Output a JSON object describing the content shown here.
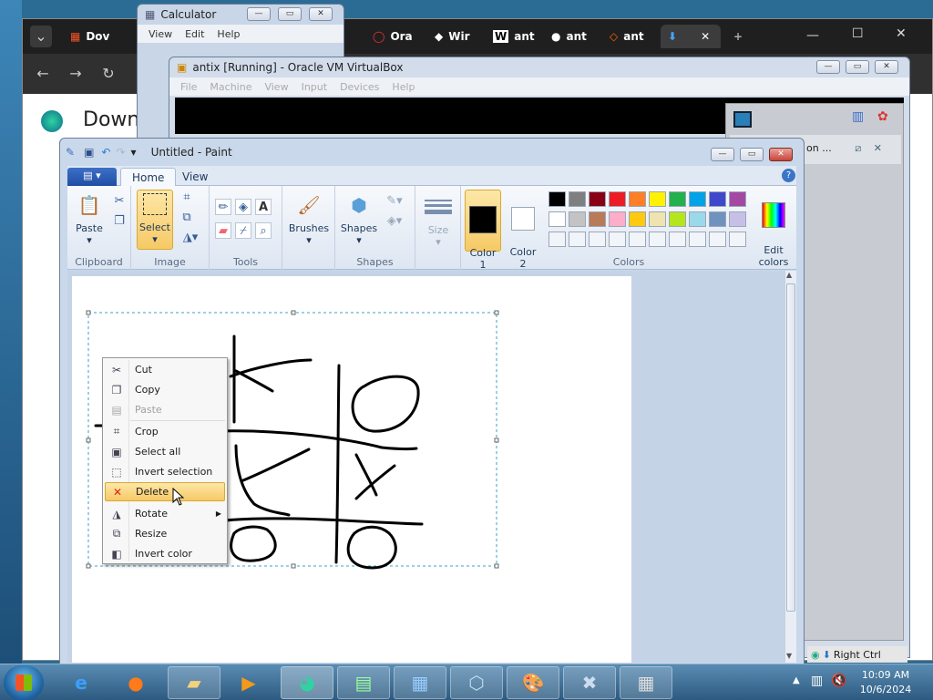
{
  "browser": {
    "tabs": [
      "Dov",
      "Ora",
      "Wir",
      "ant",
      "ant",
      "ant"
    ],
    "download_heading": "Down",
    "new_tab_symbol": "+"
  },
  "calculator": {
    "title": "Calculator",
    "menu": [
      "View",
      "Edit",
      "Help"
    ]
  },
  "virtualbox": {
    "title": "antix [Running] - Oracle VM VirtualBox",
    "menu": [
      "File",
      "Machine",
      "View",
      "Input",
      "Devices",
      "Help"
    ],
    "side_text": "on ...",
    "status_text": "Right Ctrl"
  },
  "paint": {
    "title": "Untitled - Paint",
    "file_tab": "▤ ▾",
    "tabs": [
      "Home",
      "View"
    ],
    "groups": {
      "clipboard": "Clipboard",
      "image": "Image",
      "tools": "Tools",
      "shapes": "Shapes",
      "colors": "Colors"
    },
    "buttons": {
      "paste": "Paste",
      "select": "Select",
      "brushes": "Brushes",
      "shapes": "Shapes",
      "size": "Size",
      "color1": "Color\n1",
      "color2": "Color\n2",
      "edit_colors": "Edit\ncolors"
    },
    "palette": [
      "#000000",
      "#7f7f7f",
      "#880015",
      "#ed1c24",
      "#ff7f27",
      "#fff200",
      "#22b14c",
      "#00a2e8",
      "#3f48cc",
      "#a349a4",
      "#ffffff",
      "#c3c3c3",
      "#b97a57",
      "#ffaec9",
      "#ffc90e",
      "#efe4b0",
      "#b5e61d",
      "#99d9ea",
      "#7092be",
      "#c8bfe7"
    ]
  },
  "context_menu": {
    "items": [
      {
        "label": "Cut",
        "icon": "scissors-icon",
        "enabled": true
      },
      {
        "label": "Copy",
        "icon": "copy-icon",
        "enabled": true
      },
      {
        "label": "Paste",
        "icon": "paste-icon",
        "enabled": false
      },
      {
        "label": "Crop",
        "icon": "crop-icon",
        "enabled": true
      },
      {
        "label": "Select all",
        "icon": "select-all-icon",
        "enabled": true
      },
      {
        "label": "Invert selection",
        "icon": "invert-selection-icon",
        "enabled": true
      },
      {
        "label": "Delete",
        "icon": "delete-icon",
        "enabled": true,
        "highlighted": true
      },
      {
        "label": "Rotate",
        "icon": "rotate-icon",
        "enabled": true,
        "submenu": true
      },
      {
        "label": "Resize",
        "icon": "resize-icon",
        "enabled": true
      },
      {
        "label": "Invert color",
        "icon": "invert-color-icon",
        "enabled": true
      }
    ]
  },
  "taskbar": {
    "time": "10:09 AM",
    "date": "10/6/2024"
  }
}
